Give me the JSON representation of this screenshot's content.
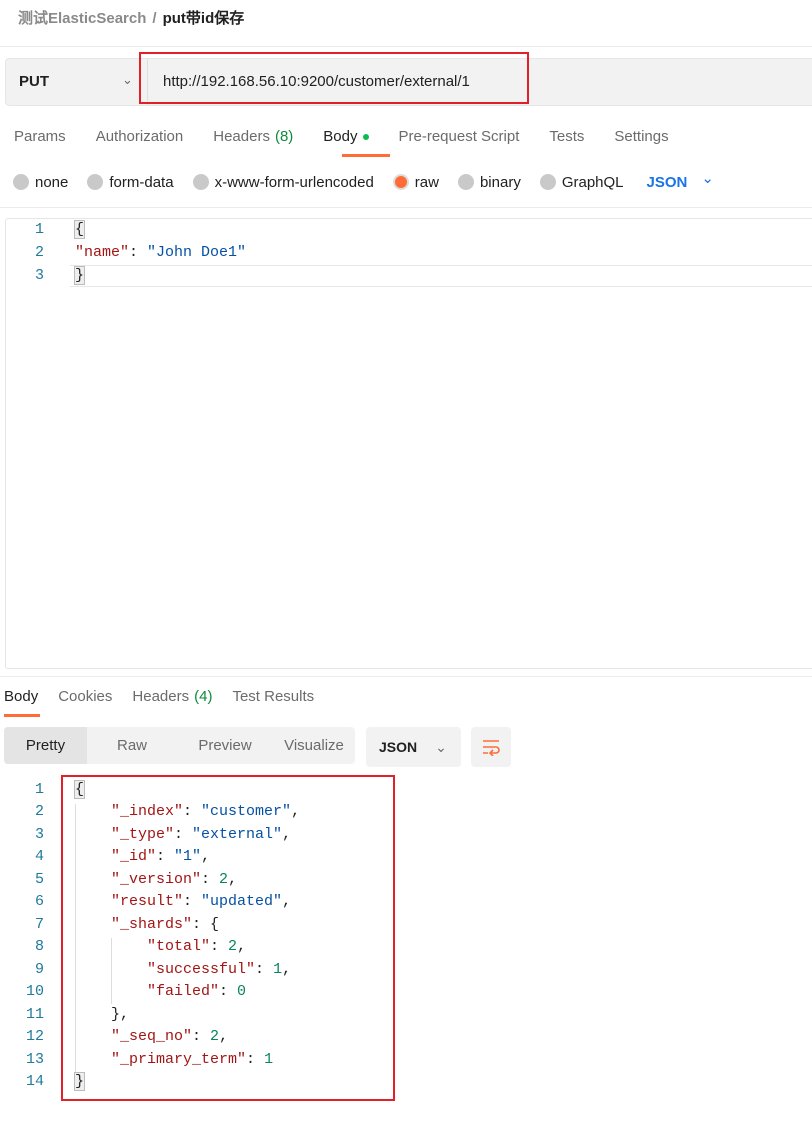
{
  "breadcrumb": {
    "parent": "测试ElasticSearch",
    "separator": "/",
    "current": "put带id保存"
  },
  "request": {
    "method": "PUT",
    "url": "http://192.168.56.10:9200/customer/external/1"
  },
  "request_tabs": [
    {
      "label": "Params"
    },
    {
      "label": "Authorization"
    },
    {
      "label": "Headers",
      "count": "(8)"
    },
    {
      "label": "Body",
      "active": true
    },
    {
      "label": "Pre-request Script"
    },
    {
      "label": "Tests"
    },
    {
      "label": "Settings"
    }
  ],
  "body_types": [
    {
      "label": "none"
    },
    {
      "label": "form-data"
    },
    {
      "label": "x-www-form-urlencoded"
    },
    {
      "label": "raw",
      "selected": true
    },
    {
      "label": "binary"
    },
    {
      "label": "GraphQL"
    }
  ],
  "body_format": "JSON",
  "request_body": [
    [
      [
        "brace",
        "{"
      ]
    ],
    [
      [
        "k",
        "\"name\""
      ],
      [
        "p",
        ": "
      ],
      [
        "s",
        "\"John Doe1\""
      ]
    ],
    [
      [
        "brace",
        "}"
      ]
    ]
  ],
  "response_tabs": [
    {
      "label": "Body",
      "active": true
    },
    {
      "label": "Cookies"
    },
    {
      "label": "Headers",
      "count": "(4)"
    },
    {
      "label": "Test Results"
    }
  ],
  "view_modes": [
    {
      "label": "Pretty",
      "active": true
    },
    {
      "label": "Raw"
    },
    {
      "label": "Preview"
    },
    {
      "label": "Visualize"
    }
  ],
  "response_format": "JSON",
  "response_body": [
    [
      [
        "brace",
        "{"
      ]
    ],
    [
      [
        "p",
        "    "
      ],
      [
        "k",
        "\"_index\""
      ],
      [
        "p",
        ": "
      ],
      [
        "s",
        "\"customer\""
      ],
      [
        "p",
        ","
      ]
    ],
    [
      [
        "p",
        "    "
      ],
      [
        "k",
        "\"_type\""
      ],
      [
        "p",
        ": "
      ],
      [
        "s",
        "\"external\""
      ],
      [
        "p",
        ","
      ]
    ],
    [
      [
        "p",
        "    "
      ],
      [
        "k",
        "\"_id\""
      ],
      [
        "p",
        ": "
      ],
      [
        "s",
        "\"1\""
      ],
      [
        "p",
        ","
      ]
    ],
    [
      [
        "p",
        "    "
      ],
      [
        "k",
        "\"_version\""
      ],
      [
        "p",
        ": "
      ],
      [
        "n",
        "2"
      ],
      [
        "p",
        ","
      ]
    ],
    [
      [
        "p",
        "    "
      ],
      [
        "k",
        "\"result\""
      ],
      [
        "p",
        ": "
      ],
      [
        "s",
        "\"updated\""
      ],
      [
        "p",
        ","
      ]
    ],
    [
      [
        "p",
        "    "
      ],
      [
        "k",
        "\"_shards\""
      ],
      [
        "p",
        ": {"
      ]
    ],
    [
      [
        "p",
        "        "
      ],
      [
        "k",
        "\"total\""
      ],
      [
        "p",
        ": "
      ],
      [
        "n",
        "2"
      ],
      [
        "p",
        ","
      ]
    ],
    [
      [
        "p",
        "        "
      ],
      [
        "k",
        "\"successful\""
      ],
      [
        "p",
        ": "
      ],
      [
        "n",
        "1"
      ],
      [
        "p",
        ","
      ]
    ],
    [
      [
        "p",
        "        "
      ],
      [
        "k",
        "\"failed\""
      ],
      [
        "p",
        ": "
      ],
      [
        "n",
        "0"
      ]
    ],
    [
      [
        "p",
        "    },"
      ]
    ],
    [
      [
        "p",
        "    "
      ],
      [
        "k",
        "\"_seq_no\""
      ],
      [
        "p",
        ": "
      ],
      [
        "n",
        "2"
      ],
      [
        "p",
        ","
      ]
    ],
    [
      [
        "p",
        "    "
      ],
      [
        "k",
        "\"_primary_term\""
      ],
      [
        "p",
        ": "
      ],
      [
        "n",
        "1"
      ]
    ],
    [
      [
        "brace",
        "}"
      ]
    ]
  ],
  "colors": {
    "accent": "#ff6c37",
    "highlight_box": "#e3202a",
    "link": "#1a73e8"
  }
}
